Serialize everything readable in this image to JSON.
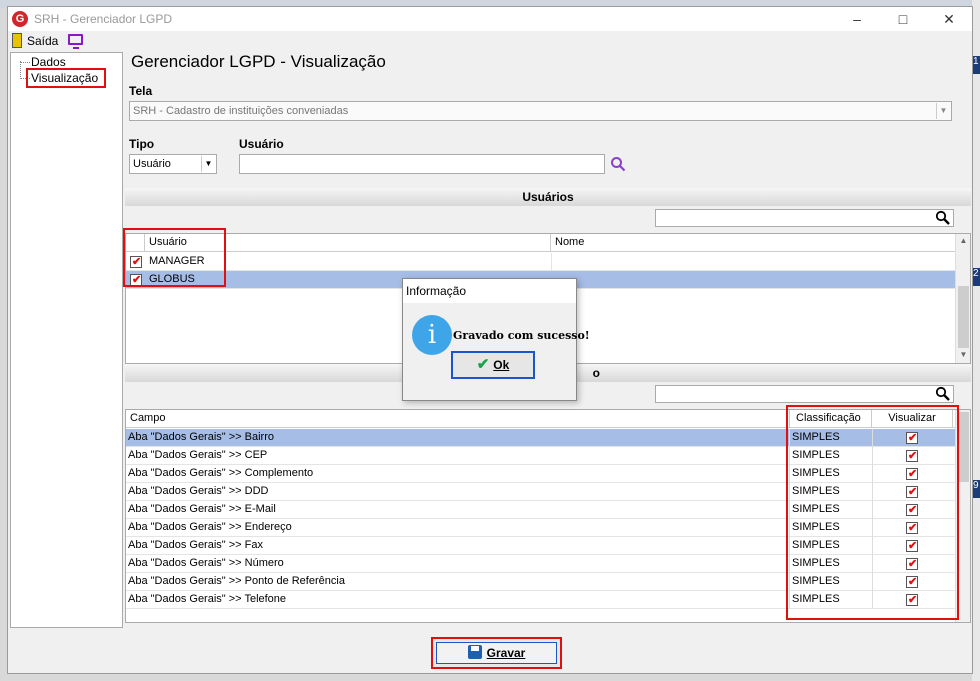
{
  "window": {
    "title": "SRH - Gerenciador LGPD",
    "app_logo": "G"
  },
  "toolbar": {
    "exit_label": "Saída"
  },
  "tree": {
    "items": [
      {
        "label": "Dados"
      },
      {
        "label": "Visualização"
      }
    ]
  },
  "page_title": "Gerenciador LGPD - Visualização",
  "tela": {
    "label": "Tela",
    "value": "SRH - Cadastro de instituições conveniadas"
  },
  "tipo": {
    "label": "Tipo",
    "value": "Usuário"
  },
  "usuario": {
    "label": "Usuário",
    "value": ""
  },
  "users_section": {
    "title": "Usuários",
    "columns": [
      "Usuário",
      "Nome"
    ],
    "rows": [
      {
        "usuario": "MANAGER",
        "nome": "",
        "checked": true,
        "selected": false
      },
      {
        "usuario": "GLOBUS",
        "nome": "",
        "checked": true,
        "selected": true
      }
    ]
  },
  "fields_section": {
    "title_visible_fragment": "o",
    "columns": [
      "Campo",
      "Classificação",
      "Visualizar"
    ],
    "rows": [
      {
        "campo": "Aba \"Dados Gerais\" >> Bairro",
        "classificacao": "SIMPLES",
        "visualizar": true,
        "selected": true
      },
      {
        "campo": "Aba \"Dados Gerais\" >> CEP",
        "classificacao": "SIMPLES",
        "visualizar": true,
        "selected": false
      },
      {
        "campo": "Aba \"Dados Gerais\" >> Complemento",
        "classificacao": "SIMPLES",
        "visualizar": true,
        "selected": false
      },
      {
        "campo": "Aba \"Dados Gerais\" >> DDD",
        "classificacao": "SIMPLES",
        "visualizar": true,
        "selected": false
      },
      {
        "campo": "Aba \"Dados Gerais\" >> E-Mail",
        "classificacao": "SIMPLES",
        "visualizar": true,
        "selected": false
      },
      {
        "campo": "Aba \"Dados Gerais\" >> Endereço",
        "classificacao": "SIMPLES",
        "visualizar": true,
        "selected": false
      },
      {
        "campo": "Aba \"Dados Gerais\" >> Fax",
        "classificacao": "SIMPLES",
        "visualizar": true,
        "selected": false
      },
      {
        "campo": "Aba \"Dados Gerais\" >> Número",
        "classificacao": "SIMPLES",
        "visualizar": true,
        "selected": false
      },
      {
        "campo": "Aba \"Dados Gerais\" >> Ponto de Referência",
        "classificacao": "SIMPLES",
        "visualizar": true,
        "selected": false
      },
      {
        "campo": "Aba \"Dados Gerais\" >> Telefone",
        "classificacao": "SIMPLES",
        "visualizar": true,
        "selected": false
      }
    ]
  },
  "dialog": {
    "title": "Informação",
    "message": "Gravado com sucesso!",
    "ok_label": "Ok"
  },
  "save_button": {
    "label": "Gravar"
  },
  "colors": {
    "selection": "#a6bde6",
    "highlight": "#e01010",
    "info": "#3ea6e8",
    "focus": "#1a56c8"
  }
}
